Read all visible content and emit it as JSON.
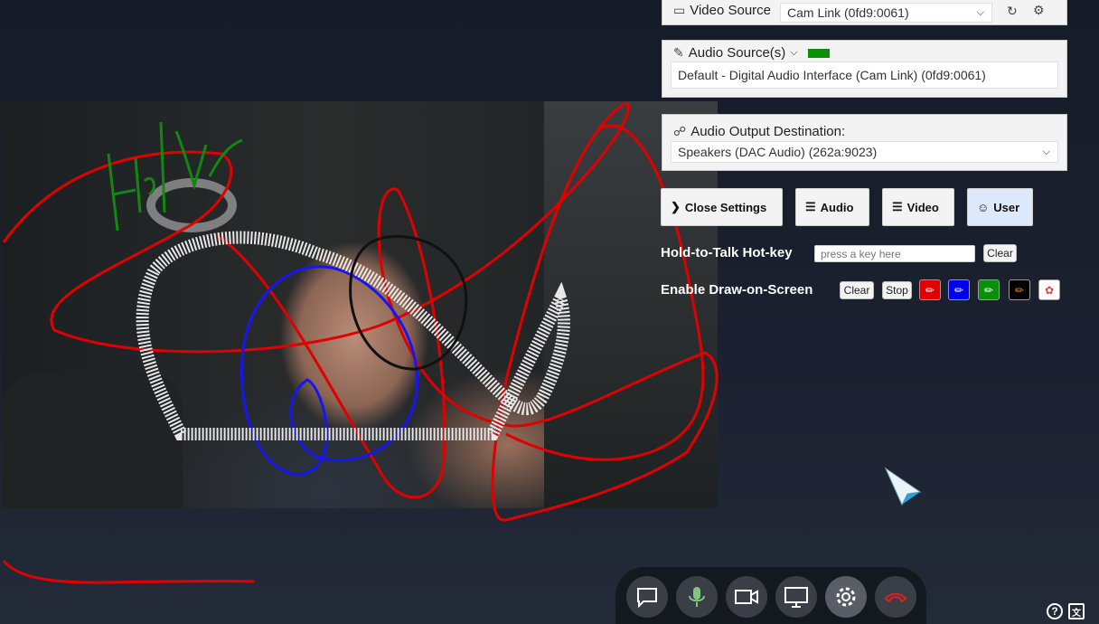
{
  "video_source": {
    "label": "Video Source",
    "value": "Cam Link (0fd9:0061)"
  },
  "audio_source": {
    "label": "Audio Source(s)",
    "value": "Default - Digital Audio Interface (Cam Link) (0fd9:0061)",
    "meter_color": "#0a8f0a"
  },
  "audio_output": {
    "label": "Audio Output Destination:",
    "value": "Speakers (DAC Audio) (262a:9023)"
  },
  "buttons": {
    "close_settings": "Close Settings",
    "audio": "Audio",
    "video": "Video",
    "user": "User"
  },
  "hotkey": {
    "label": "Hold-to-Talk Hot-key",
    "placeholder": "press a key here",
    "clear": "Clear"
  },
  "draw": {
    "label": "Enable Draw-on-Screen",
    "clear": "Clear",
    "stop": "Stop",
    "pen_colors": [
      "#e00000",
      "#0000ee",
      "#0a8f0a",
      "#000000",
      "#ffffff"
    ]
  },
  "toolbar": {
    "icons": [
      "chat-icon",
      "microphone-icon",
      "camera-icon",
      "screenshare-icon",
      "settings-icon",
      "hangup-icon"
    ]
  },
  "corner": {
    "help": "?",
    "translate": "文"
  }
}
